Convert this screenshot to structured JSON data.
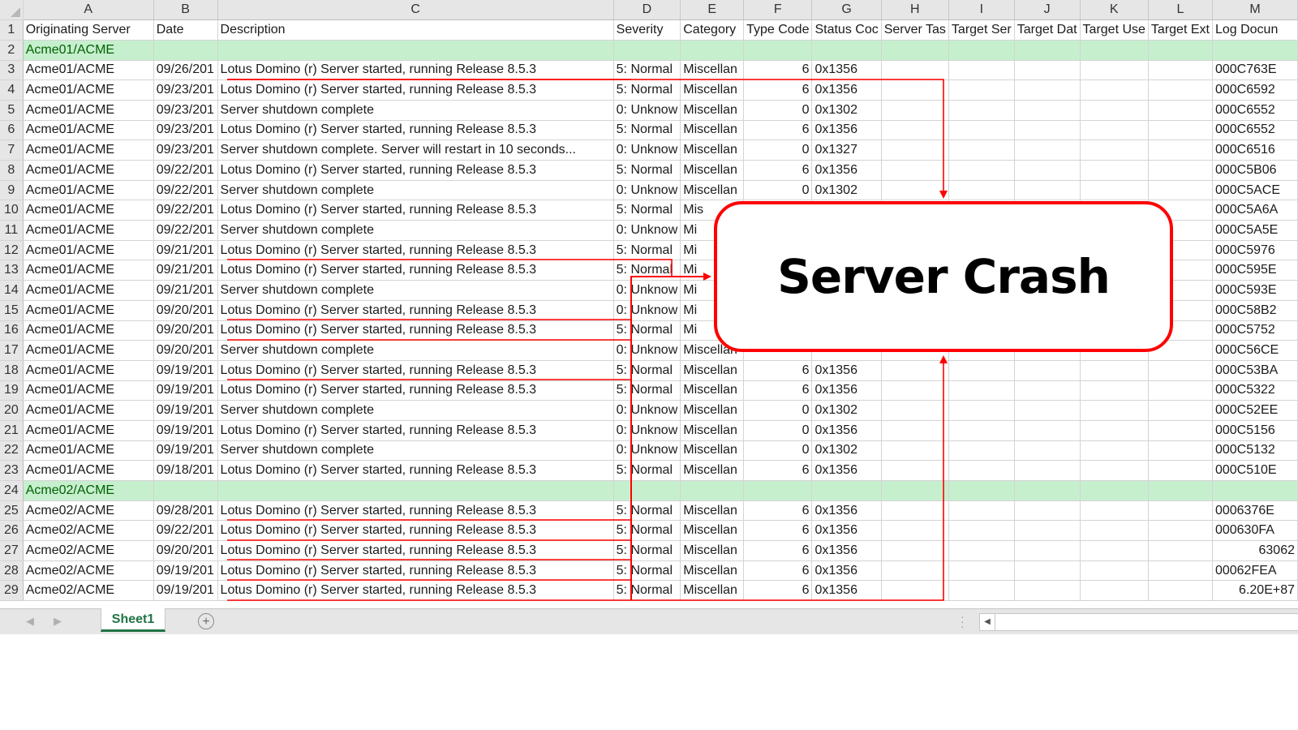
{
  "spreadsheet": {
    "column_letters": [
      "A",
      "B",
      "C",
      "D",
      "E",
      "F",
      "G",
      "H",
      "I",
      "J",
      "K",
      "L",
      "M"
    ],
    "header_row": {
      "row_number": "1",
      "cells": [
        "Originating Server",
        "Date",
        "Description",
        "Severity",
        "Category",
        "Type Code",
        "Status Coc",
        "Server Tas",
        "Target Ser",
        "Target Dat",
        "Target Use",
        "Target Ext",
        "Log Docun"
      ]
    },
    "rows": [
      {
        "n": "2",
        "group": true,
        "label": "Acme01/ACME"
      },
      {
        "n": "3",
        "a": "Acme01/ACME",
        "b": "09/26/201",
        "c": "Lotus Domino (r) Server started, running Release 8.5.3",
        "d": "5: Normal",
        "e": "Miscellan",
        "f": "6",
        "g": "0x1356",
        "m": "000C763E"
      },
      {
        "n": "4",
        "a": "Acme01/ACME",
        "b": "09/23/201",
        "c": "Lotus Domino (r) Server started, running Release 8.5.3",
        "d": "5: Normal",
        "e": "Miscellan",
        "f": "6",
        "g": "0x1356",
        "m": "000C6592"
      },
      {
        "n": "5",
        "a": "Acme01/ACME",
        "b": "09/23/201",
        "c": "Server shutdown complete",
        "d": "0: Unknow",
        "e": "Miscellan",
        "f": "0",
        "g": "0x1302",
        "m": "000C6552"
      },
      {
        "n": "6",
        "a": "Acme01/ACME",
        "b": "09/23/201",
        "c": "Lotus Domino (r) Server started, running Release 8.5.3",
        "d": "5: Normal",
        "e": "Miscellan",
        "f": "6",
        "g": "0x1356",
        "m": "000C6552"
      },
      {
        "n": "7",
        "a": "Acme01/ACME",
        "b": "09/23/201",
        "c": "Server shutdown complete. Server will restart in 10 seconds...",
        "d": "0: Unknow",
        "e": "Miscellan",
        "f": "0",
        "g": "0x1327",
        "m": "000C6516"
      },
      {
        "n": "8",
        "a": "Acme01/ACME",
        "b": "09/22/201",
        "c": "Lotus Domino (r) Server started, running Release 8.5.3",
        "d": "5: Normal",
        "e": "Miscellan",
        "f": "6",
        "g": "0x1356",
        "m": "000C5B06"
      },
      {
        "n": "9",
        "a": "Acme01/ACME",
        "b": "09/22/201",
        "c": "Server shutdown complete",
        "d": "0: Unknow",
        "e": "Miscellan",
        "f": "0",
        "g": "0x1302",
        "m": "000C5ACE"
      },
      {
        "n": "10",
        "a": "Acme01/ACME",
        "b": "09/22/201",
        "c": "Lotus Domino (r) Server started, running Release 8.5.3",
        "d": "5: Normal",
        "e": "Mis",
        "f": "",
        "g": "",
        "m": "000C5A6A"
      },
      {
        "n": "11",
        "a": "Acme01/ACME",
        "b": "09/22/201",
        "c": "Server shutdown complete",
        "d": "0: Unknow",
        "e": "Mi",
        "f": "",
        "g": "",
        "m": "000C5A5E"
      },
      {
        "n": "12",
        "a": "Acme01/ACME",
        "b": "09/21/201",
        "c": "Lotus Domino (r) Server started, running Release 8.5.3",
        "d": "5: Normal",
        "e": "Mi",
        "f": "",
        "g": "",
        "m": "000C5976"
      },
      {
        "n": "13",
        "a": "Acme01/ACME",
        "b": "09/21/201",
        "c": "Lotus Domino (r) Server started, running Release 8.5.3",
        "d": "5: Normal",
        "e": "Mi",
        "f": "",
        "g": "",
        "m": "000C595E"
      },
      {
        "n": "14",
        "a": "Acme01/ACME",
        "b": "09/21/201",
        "c": "Server shutdown complete",
        "d": "0: Unknow",
        "e": "Mi",
        "f": "",
        "g": "",
        "m": "000C593E"
      },
      {
        "n": "15",
        "a": "Acme01/ACME",
        "b": "09/20/201",
        "c": "Lotus Domino (r) Server started, running Release 8.5.3",
        "d": "0: Unknow",
        "e": "Mi",
        "f": "",
        "g": "",
        "m": "000C58B2"
      },
      {
        "n": "16",
        "a": "Acme01/ACME",
        "b": "09/20/201",
        "c": "Lotus Domino (r) Server started, running Release 8.5.3",
        "d": "5: Normal",
        "e": "Mi",
        "f": "",
        "g": "",
        "m": "000C5752"
      },
      {
        "n": "17",
        "a": "Acme01/ACME",
        "b": "09/20/201",
        "c": "Server shutdown complete",
        "d": "0: Unknow",
        "e": "Miscellan",
        "f": "",
        "g": "",
        "m": "000C56CE"
      },
      {
        "n": "18",
        "a": "Acme01/ACME",
        "b": "09/19/201",
        "c": "Lotus Domino (r) Server started, running Release 8.5.3",
        "d": "5: Normal",
        "e": "Miscellan",
        "f": "6",
        "g": "0x1356",
        "m": "000C53BA"
      },
      {
        "n": "19",
        "a": "Acme01/ACME",
        "b": "09/19/201",
        "c": "Lotus Domino (r) Server started, running Release 8.5.3",
        "d": "5: Normal",
        "e": "Miscellan",
        "f": "6",
        "g": "0x1356",
        "m": "000C5322"
      },
      {
        "n": "20",
        "a": "Acme01/ACME",
        "b": "09/19/201",
        "c": "Server shutdown complete",
        "d": "0: Unknow",
        "e": "Miscellan",
        "f": "0",
        "g": "0x1302",
        "m": "000C52EE"
      },
      {
        "n": "21",
        "a": "Acme01/ACME",
        "b": "09/19/201",
        "c": "Lotus Domino (r) Server started, running Release 8.5.3",
        "d": "0: Unknow",
        "e": "Miscellan",
        "f": "0",
        "g": "0x1356",
        "m": "000C5156"
      },
      {
        "n": "22",
        "a": "Acme01/ACME",
        "b": "09/19/201",
        "c": "Server shutdown complete",
        "d": "0: Unknow",
        "e": "Miscellan",
        "f": "0",
        "g": "0x1302",
        "m": "000C5132"
      },
      {
        "n": "23",
        "a": "Acme01/ACME",
        "b": "09/18/201",
        "c": "Lotus Domino (r) Server started, running Release 8.5.3",
        "d": "5: Normal",
        "e": "Miscellan",
        "f": "6",
        "g": "0x1356",
        "m": "000C510E"
      },
      {
        "n": "24",
        "group": true,
        "label": "Acme02/ACME"
      },
      {
        "n": "25",
        "a": "Acme02/ACME",
        "b": "09/28/201",
        "c": "Lotus Domino (r) Server started, running Release 8.5.3",
        "d": "5: Normal",
        "e": "Miscellan",
        "f": "6",
        "g": "0x1356",
        "m": "0006376E"
      },
      {
        "n": "26",
        "a": "Acme02/ACME",
        "b": "09/22/201",
        "c": "Lotus Domino (r) Server started, running Release 8.5.3",
        "d": "5: Normal",
        "e": "Miscellan",
        "f": "6",
        "g": "0x1356",
        "m": "000630FA"
      },
      {
        "n": "27",
        "a": "Acme02/ACME",
        "b": "09/20/201",
        "c": "Lotus Domino (r) Server started, running Release 8.5.3",
        "d": "5: Normal",
        "e": "Miscellan",
        "f": "6",
        "g": "0x1356",
        "m": "63062",
        "m_num": true
      },
      {
        "n": "28",
        "a": "Acme02/ACME",
        "b": "09/19/201",
        "c": "Lotus Domino (r) Server started, running Release 8.5.3",
        "d": "5: Normal",
        "e": "Miscellan",
        "f": "6",
        "g": "0x1356",
        "m": "00062FEA"
      },
      {
        "n": "29",
        "a": "Acme02/ACME",
        "b": "09/19/201",
        "c": "Lotus Domino (r) Server started, running Release 8.5.3",
        "d": "5: Normal",
        "e": "Miscellan",
        "f": "6",
        "g": "0x1356",
        "m": "6.20E+87",
        "m_num": true
      }
    ]
  },
  "callout": {
    "text": "Server Crash"
  },
  "annotation_colors": {
    "callout_border": "#ff0000",
    "connector": "#ff0000",
    "group_fill": "#c6efce",
    "group_text": "#006100",
    "sheet_tab_accent": "#217346"
  },
  "tabbar": {
    "sheet_tab_label": "Sheet1",
    "prev_icon": "◀",
    "next_icon": "▶",
    "add_icon": "+",
    "scroll_left_icon": "◀"
  }
}
